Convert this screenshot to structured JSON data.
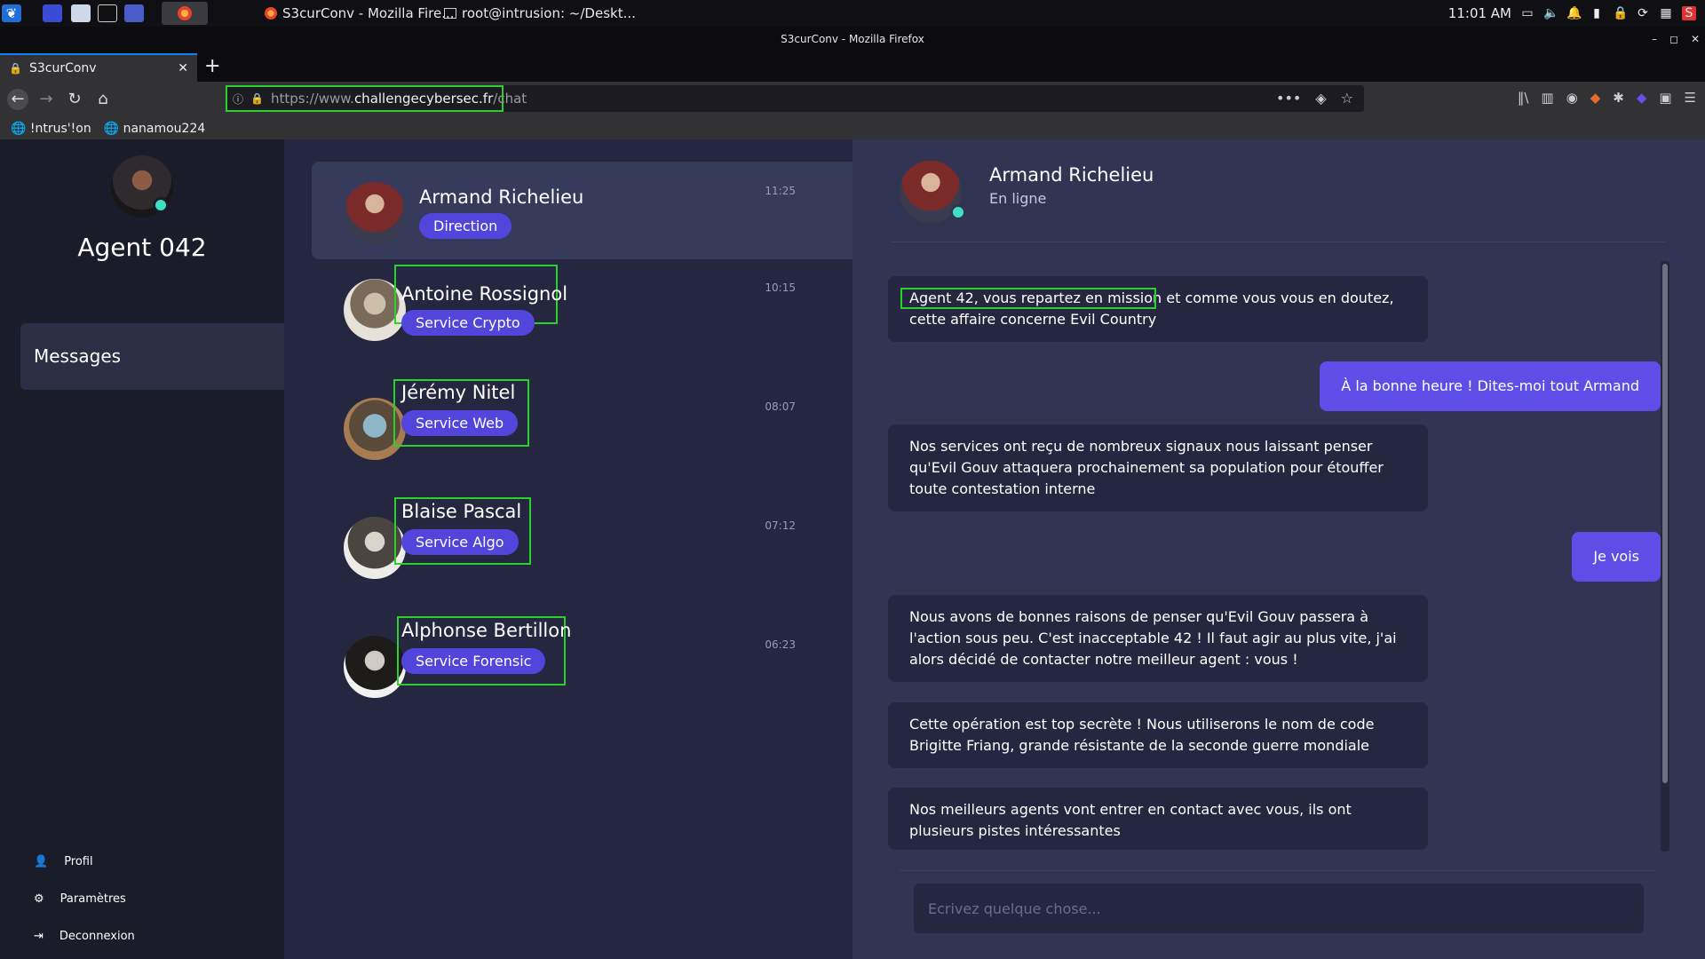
{
  "taskbar": {
    "tasks": [
      {
        "label": "S3curConv - Mozilla Fire..."
      },
      {
        "label": "root@intrusion: ~/Deskt..."
      }
    ],
    "clock": "11:01 AM"
  },
  "browser": {
    "window_title": "S3curConv - Mozilla Firefox",
    "tab_title": "S3curConv",
    "url_prefix": "https://www.",
    "url_domain": "challengecybersec.fr",
    "url_path": "/chat",
    "bookmarks": [
      "!ntrus'!on",
      "nanamou224"
    ]
  },
  "sidebar": {
    "agent_name": "Agent 042",
    "menu_messages": "Messages",
    "bottom": {
      "profile": "Profil",
      "settings": "Paramètres",
      "logout": "Deconnexion"
    }
  },
  "conversations": [
    {
      "name": "Armand Richelieu",
      "badge": "Direction",
      "time": "11:25"
    },
    {
      "name": "Antoine Rossignol",
      "badge": "Service Crypto",
      "time": "10:15"
    },
    {
      "name": "Jérémy Nitel",
      "badge": "Service Web",
      "time": "08:07"
    },
    {
      "name": "Blaise Pascal",
      "badge": "Service Algo",
      "time": "07:12"
    },
    {
      "name": "Alphonse Bertillon",
      "badge": "Service Forensic",
      "time": "06:23"
    }
  ],
  "chat": {
    "contact_name": "Armand Richelieu",
    "contact_status": "En ligne",
    "messages": [
      {
        "from": "them",
        "text": "Agent 42, vous repartez en mission et comme vous vous en doutez, cette affaire concerne Evil Country"
      },
      {
        "from": "me",
        "text": "À la bonne heure ! Dites-moi tout Armand"
      },
      {
        "from": "them",
        "text": "Nos services ont reçu de nombreux signaux nous laissant penser qu'Evil Gouv attaquera prochainement sa population pour étouffer toute contestation interne"
      },
      {
        "from": "me",
        "text": "Je vois"
      },
      {
        "from": "them",
        "text": "Nous avons de bonnes raisons de penser qu'Evil Gouv passera à l'action sous peu. C'est inacceptable 42 ! Il faut agir au plus vite, j'ai alors décidé de contacter notre meilleur agent : vous !"
      },
      {
        "from": "them",
        "text": "Cette opération est top secrète ! Nous utiliserons le nom de code Brigitte Friang, grande résistante de la seconde guerre mondiale"
      },
      {
        "from": "them",
        "text": "Nos meilleurs agents vont entrer en contact avec vous, ils ont plusieurs pistes intéressantes"
      }
    ],
    "composer_placeholder": "Ecrivez quelque chose..."
  },
  "colors": {
    "accent": "#5145dc",
    "own_message": "#5d4ee8",
    "online": "#3ee0c4",
    "highlight": "#2bd12b"
  }
}
